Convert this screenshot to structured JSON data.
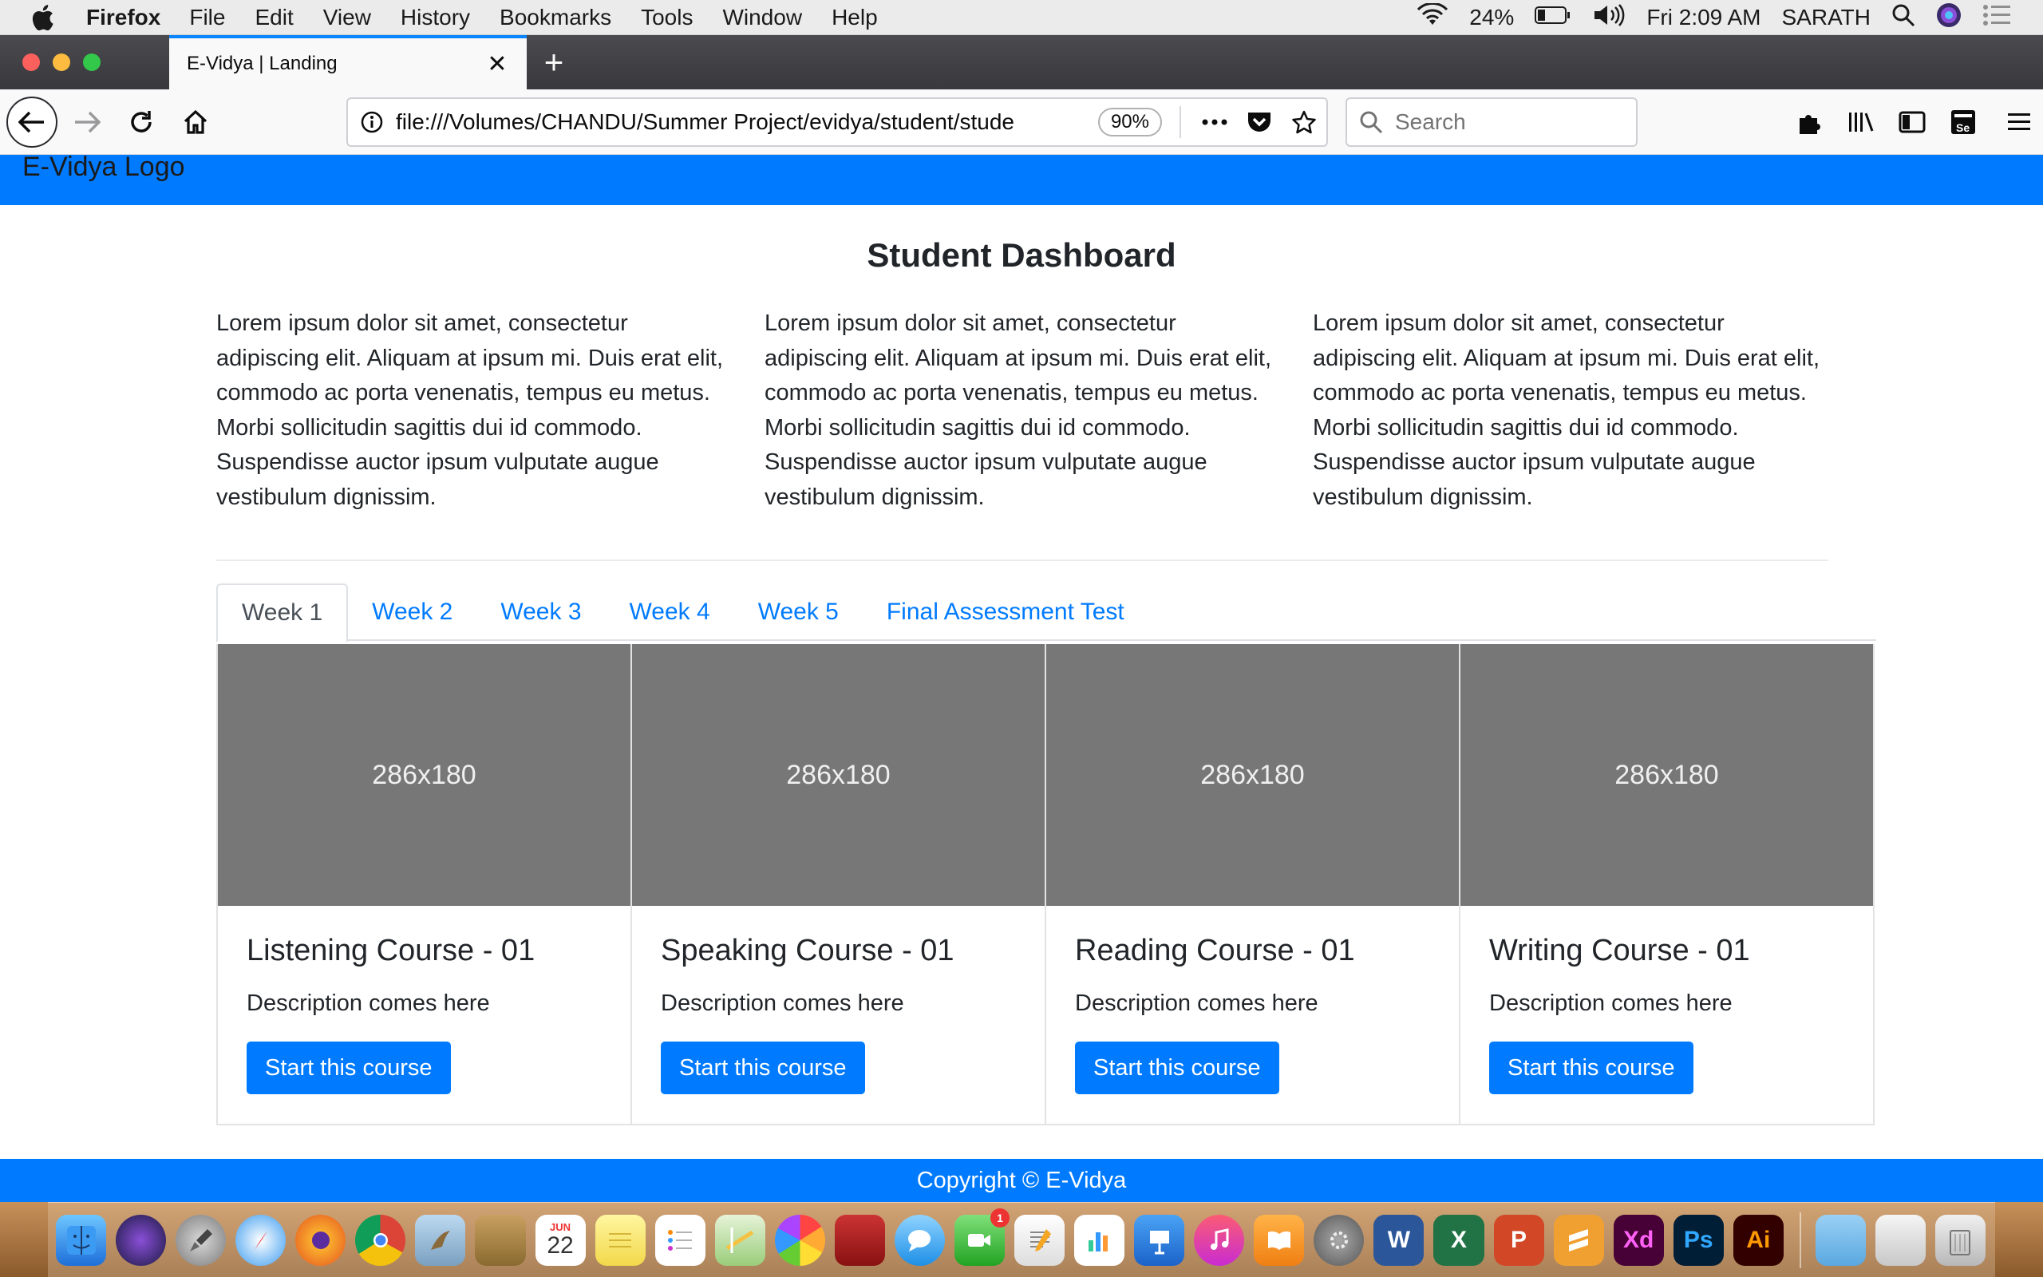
{
  "menubar": {
    "app_name": "Firefox",
    "menus": [
      "File",
      "Edit",
      "View",
      "History",
      "Bookmarks",
      "Tools",
      "Window",
      "Help"
    ],
    "battery": "24%",
    "clock": "Fri 2:09 AM",
    "user": "SARATH"
  },
  "browser": {
    "tab_title": "E-Vidya | Landing",
    "url": "file:///Volumes/CHANDU/Summer Project/evidya/student/stude",
    "zoom": "90%",
    "search_placeholder": "Search"
  },
  "site": {
    "logo_text": "E-Vidya Logo",
    "page_title": "Student Dashboard",
    "columns": [
      "Lorem ipsum dolor sit amet, consectetur adipiscing elit. Aliquam at ipsum mi. Duis erat elit, commodo ac porta venenatis, tempus eu metus. Morbi sollicitudin sagittis dui id commodo. Suspendisse auctor ipsum vulputate augue vestibulum dignissim.",
      "Lorem ipsum dolor sit amet, consectetur adipiscing elit. Aliquam at ipsum mi. Duis erat elit, commodo ac porta venenatis, tempus eu metus. Morbi sollicitudin sagittis dui id commodo. Suspendisse auctor ipsum vulputate augue vestibulum dignissim.",
      "Lorem ipsum dolor sit amet, consectetur adipiscing elit. Aliquam at ipsum mi. Duis erat elit, commodo ac porta venenatis, tempus eu metus. Morbi sollicitudin sagittis dui id commodo. Suspendisse auctor ipsum vulputate augue vestibulum dignissim."
    ],
    "tabs": [
      "Week 1",
      "Week 2",
      "Week 3",
      "Week 4",
      "Week 5",
      "Final Assessment Test"
    ],
    "active_tab": "Week 1",
    "cards": [
      {
        "image_label": "286x180",
        "title": "Listening Course - 01",
        "description": "Description comes here",
        "button": "Start this course"
      },
      {
        "image_label": "286x180",
        "title": "Speaking Course - 01",
        "description": "Description comes here",
        "button": "Start this course"
      },
      {
        "image_label": "286x180",
        "title": "Reading Course - 01",
        "description": "Description comes here",
        "button": "Start this course"
      },
      {
        "image_label": "286x180",
        "title": "Writing Course - 01",
        "description": "Description comes here",
        "button": "Start this course"
      }
    ],
    "footer": "Copyright © E-Vidya"
  },
  "dock": {
    "calendar_month": "JUN",
    "calendar_day": "22",
    "facetime_badge": "1",
    "word_label": "W",
    "excel_label": "X",
    "powerpoint_label": "P",
    "xd_label": "Xd",
    "ps_label": "Ps",
    "ai_label": "Ai"
  },
  "colors": {
    "accent": "#007bff",
    "firefox_tab_highlight": "#0a84ff",
    "placeholder_gray": "#777777"
  }
}
